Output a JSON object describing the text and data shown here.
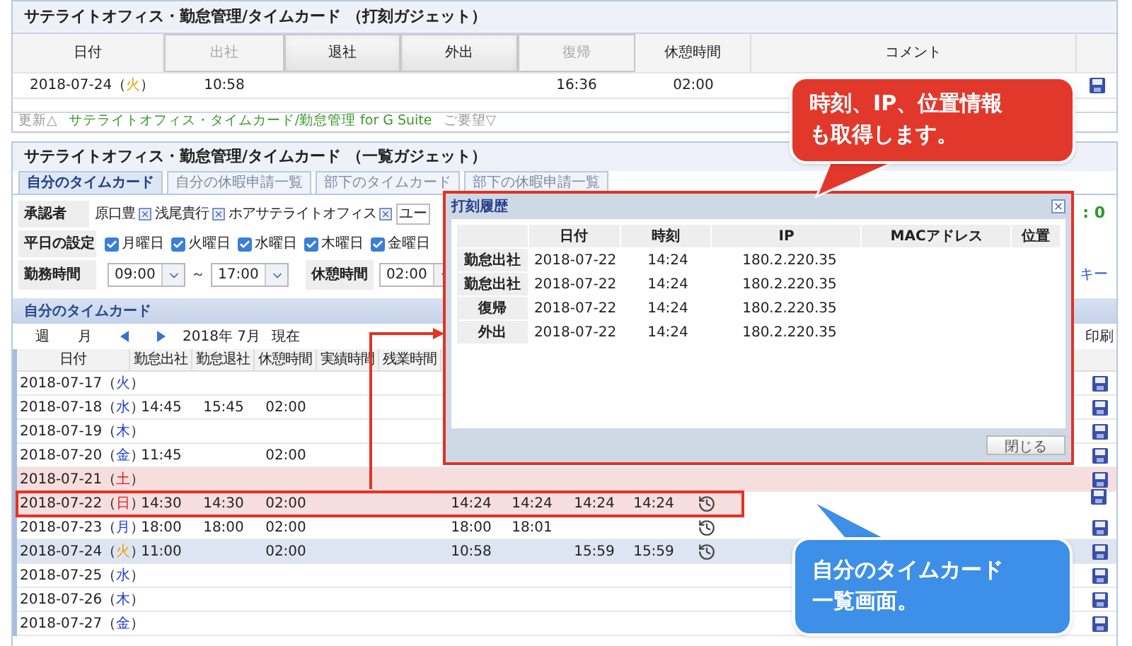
{
  "punch_gadget": {
    "title": "サテライトオフィス・勤怠管理/タイムカード （打刻ガジェット）",
    "columns": [
      {
        "label": "日付",
        "kind": "label",
        "disabled": false
      },
      {
        "label": "出社",
        "kind": "button",
        "disabled": true
      },
      {
        "label": "退社",
        "kind": "button",
        "disabled": false
      },
      {
        "label": "外出",
        "kind": "button",
        "disabled": false
      },
      {
        "label": "復帰",
        "kind": "button",
        "disabled": true
      },
      {
        "label": "休憩時間",
        "kind": "label",
        "disabled": false
      },
      {
        "label": "コメント",
        "kind": "label",
        "disabled": false
      }
    ],
    "row": {
      "date": "2018-07-24（",
      "day": "火",
      "close": "）",
      "kind": "today",
      "clock_in": "10:58",
      "return": "16:36",
      "break": "02:00"
    },
    "footer": {
      "update": "更新△",
      "link": "サテライトオフィス・タイムカード/勤怠管理 for G Suite",
      "request": "ご要望▽"
    }
  },
  "list_gadget": {
    "title": "サテライトオフィス・勤怠管理/タイムカード （一覧ガジェット）",
    "tabs": [
      {
        "label": "自分のタイムカード",
        "selected": true
      },
      {
        "label": "自分の休暇申請一覧",
        "selected": false
      },
      {
        "label": "部下のタイムカード",
        "selected": false
      },
      {
        "label": "部下の休暇申請一覧",
        "selected": false
      }
    ],
    "approvers": {
      "label": "承認者",
      "names": [
        "原口豊",
        "浅尾貴行",
        "ホアサテライトオフィス"
      ],
      "select": "ユー",
      "remaining": ": 0"
    },
    "weekdays": {
      "label": "平日の設定",
      "days": [
        {
          "label": "月曜日",
          "checked": true
        },
        {
          "label": "火曜日",
          "checked": true
        },
        {
          "label": "水曜日",
          "checked": true
        },
        {
          "label": "木曜日",
          "checked": true
        },
        {
          "label": "金曜日",
          "checked": true
        }
      ]
    },
    "hours": {
      "label": "勤務時間",
      "start": "09:00",
      "separator": "～",
      "end": "17:00",
      "break_label": "休憩時間",
      "break": "02:00",
      "link": "キー"
    },
    "section": "自分のタイムカード",
    "nav": {
      "week": "週",
      "month": "月",
      "period": "2018年 7月",
      "current": "現在",
      "print": "印刷"
    },
    "columns": [
      "日付",
      "勤怠出社",
      "勤怠退社",
      "休憩時間",
      "実績時間",
      "残業時間"
    ],
    "rows": [
      {
        "date": "2018-07-17（",
        "day": "火",
        "close": "）",
        "kind": "weekday",
        "annotated": false,
        "history": false
      },
      {
        "date": "2018-07-18（",
        "day": "水",
        "close": "）",
        "kind": "weekday",
        "annotated": false,
        "history": false,
        "clock_in": "14:45",
        "clock_out": "15:45",
        "break": "02:00"
      },
      {
        "date": "2018-07-19（",
        "day": "木",
        "close": "）",
        "kind": "weekday",
        "annotated": false,
        "history": false
      },
      {
        "date": "2018-07-20（",
        "day": "金",
        "close": "）",
        "kind": "weekday",
        "annotated": false,
        "history": false,
        "clock_in": "11:45",
        "break": "02:00"
      },
      {
        "date": "2018-07-21（",
        "day": "土",
        "close": "）",
        "kind": "holiday",
        "annotated": false,
        "history": false
      },
      {
        "date": "2018-07-22（",
        "day": "日",
        "close": "）",
        "kind": "holiday",
        "annotated": true,
        "history": true,
        "clock_in": "14:30",
        "clock_out": "14:30",
        "break": "02:00",
        "column_7": "14:24",
        "column_8": "14:24",
        "column_9": "14:24",
        "column_10": "14:24"
      },
      {
        "date": "2018-07-23（",
        "day": "月",
        "close": "）",
        "kind": "weekday",
        "annotated": false,
        "history": true,
        "clock_in": "18:00",
        "clock_out": "18:00",
        "break": "02:00",
        "column_7": "18:00",
        "column_8": "18:01"
      },
      {
        "date": "2018-07-24（",
        "day": "火",
        "close": "）",
        "kind": "today",
        "annotated": false,
        "history": true,
        "clock_in": "11:00",
        "break": "02:00",
        "column_7": "10:58",
        "column_9": "15:59",
        "column_10": "15:59"
      },
      {
        "date": "2018-07-25（",
        "day": "水",
        "close": "）",
        "kind": "weekday",
        "annotated": false,
        "history": false
      },
      {
        "date": "2018-07-26（",
        "day": "木",
        "close": "）",
        "kind": "weekday",
        "annotated": false,
        "history": false
      },
      {
        "date": "2018-07-27（",
        "day": "金",
        "close": "）",
        "kind": "weekday",
        "annotated": false,
        "history": false
      }
    ]
  },
  "dialog": {
    "title": "打刻履歴",
    "columns": [
      "日付",
      "時刻",
      "IP",
      "MACアドレス",
      "位置"
    ],
    "rows": [
      {
        "label": "勤怠出社",
        "date": "2018-07-22",
        "time": "14:24",
        "ip": "180.2.220.35"
      },
      {
        "label": "勤怠出社",
        "date": "2018-07-22",
        "time": "14:24",
        "ip": "180.2.220.35"
      },
      {
        "label": "復帰",
        "date": "2018-07-22",
        "time": "14:24",
        "ip": "180.2.220.35"
      },
      {
        "label": "外出",
        "date": "2018-07-22",
        "time": "14:24",
        "ip": "180.2.220.35"
      }
    ],
    "close": "閉じる"
  },
  "callouts": [
    {
      "lines": [
        "時刻、IP、位置情報",
        "も取得します。"
      ],
      "color": "#e2382b"
    },
    {
      "lines": [
        "自分のタイムカード",
        "一覧画面。"
      ],
      "color": "#3d8fe8"
    }
  ]
}
